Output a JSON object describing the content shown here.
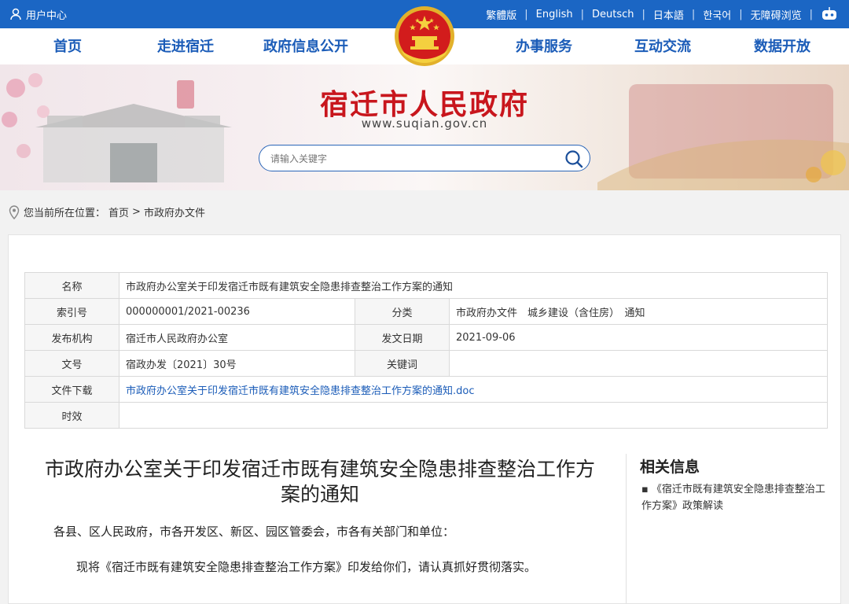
{
  "topbar": {
    "user_center": "用户中心",
    "languages": [
      "繁體版",
      "English",
      "Deutsch",
      "日本語",
      "한국어",
      "无障碍浏览"
    ],
    "robot_icon": "robot-icon"
  },
  "nav": {
    "items": [
      "首页",
      "走进宿迁",
      "政府信息公开",
      "办事服务",
      "互动交流",
      "数据开放"
    ]
  },
  "banner": {
    "title": "宿迁市人民政府",
    "url": "www.suqian.gov.cn",
    "search_placeholder": "请输入关键字"
  },
  "breadcrumb": {
    "prefix": "您当前所在位置：",
    "home": "首页",
    "separator": ">",
    "current": "市政府办文件"
  },
  "meta": {
    "name_label": "名称",
    "name_value": "市政府办公室关于印发宿迁市既有建筑安全隐患排查整治工作方案的通知",
    "index_label": "索引号",
    "index_value": "000000001/2021-00236",
    "category_label": "分类",
    "category_value": "市政府办文件　城乡建设（含住房）　通知",
    "publisher_label": "发布机构",
    "publisher_value": "宿迁市人民政府办公室",
    "date_label": "发文日期",
    "date_value": "2021-09-06",
    "docno_label": "文号",
    "docno_value": "宿政办发〔2021〕30号",
    "keyword_label": "关键词",
    "keyword_value": "",
    "download_label": "文件下载",
    "download_value": "市政府办公室关于印发宿迁市既有建筑安全隐患排查整治工作方案的通知.doc",
    "validity_label": "时效",
    "validity_value": ""
  },
  "article": {
    "title_line1": "市政府办公室关于印发宿迁市既有建筑安全隐患排查整治工作方",
    "title_line2": "案的通知",
    "para1": "各县、区人民政府，市各开发区、新区、园区管委会，市各有关部门和单位：",
    "para2": "现将《宿迁市既有建筑安全隐患排查整治工作方案》印发给你们，请认真抓好贯彻落实。"
  },
  "related": {
    "title": "相关信息",
    "items": [
      "《宿迁市既有建筑安全隐患排查整治工作方案》政策解读"
    ]
  },
  "colors": {
    "topbar": "#1b66c4",
    "nav_text": "#1b5cb8",
    "title_red": "#c8161d"
  }
}
